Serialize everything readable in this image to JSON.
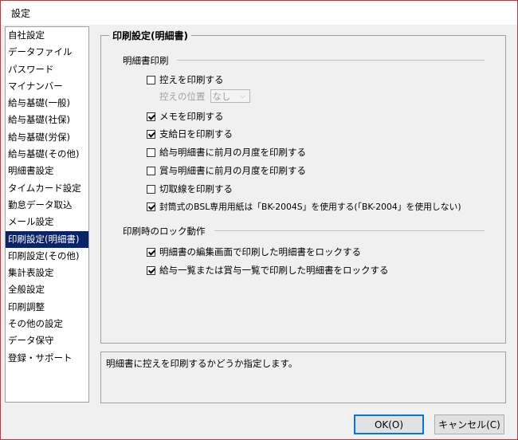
{
  "window": {
    "title": "設定"
  },
  "sidebar": {
    "items": [
      {
        "label": "自社設定"
      },
      {
        "label": "データファイル"
      },
      {
        "label": "パスワード"
      },
      {
        "label": "マイナンバー"
      },
      {
        "label": "給与基礎(一般)"
      },
      {
        "label": "給与基礎(社保)"
      },
      {
        "label": "給与基礎(労保)"
      },
      {
        "label": "給与基礎(その他)"
      },
      {
        "label": "明細書設定"
      },
      {
        "label": "タイムカード設定"
      },
      {
        "label": "勤怠データ取込"
      },
      {
        "label": "メール設定"
      },
      {
        "label": "印刷設定(明細書)",
        "selected": true
      },
      {
        "label": "印刷設定(その他)"
      },
      {
        "label": "集計表設定"
      },
      {
        "label": "全般設定"
      },
      {
        "label": "印刷調整"
      },
      {
        "label": "その他の設定"
      },
      {
        "label": "データ保守"
      },
      {
        "label": "登録・サポート"
      }
    ],
    "selected_color": "#0a246a"
  },
  "panel": {
    "title": "印刷設定(明細書)",
    "group1": {
      "heading": "明細書印刷",
      "print_copy": {
        "label": "控えを印刷する",
        "checked": false
      },
      "copy_position": {
        "label": "控えの位置",
        "value": "なし"
      },
      "print_memo": {
        "label": "メモを印刷する",
        "checked": true
      },
      "print_payday": {
        "label": "支給日を印刷する",
        "checked": true
      },
      "prev_month_salary": {
        "label": "給与明細書に前月の月度を印刷する",
        "checked": false
      },
      "prev_month_bonus": {
        "label": "賞与明細書に前月の月度を印刷する",
        "checked": false
      },
      "cut_line": {
        "label": "切取線を印刷する",
        "checked": false
      },
      "envelope_paper": {
        "label": "封筒式のBSL専用用紙は「BK-2004S」を使用する(「BK-2004」を使用しない)",
        "checked": true
      }
    },
    "group2": {
      "heading": "印刷時のロック動作",
      "lock_edit": {
        "label": "明細書の編集画面で印刷した明細書をロックする",
        "checked": true
      },
      "lock_list": {
        "label": "給与一覧または賞与一覧で印刷した明細書をロックする",
        "checked": true
      }
    }
  },
  "description": "明細書に控えを印刷するかどうか指定します。",
  "buttons": {
    "ok": "OK(O)",
    "cancel": "キャンセル(C)"
  }
}
